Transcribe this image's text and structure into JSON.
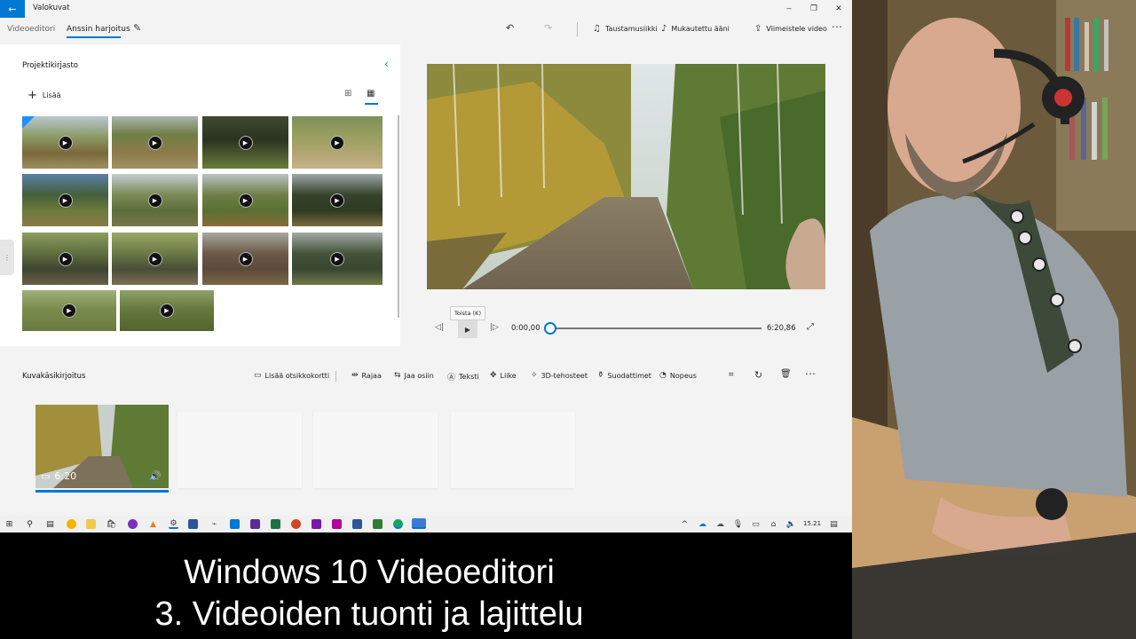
{
  "app": {
    "title": "Valokuvat",
    "back_icon": "back-arrow-icon",
    "window_controls": {
      "minimize": "‒",
      "maximize": "❐",
      "close": "✕"
    }
  },
  "nav": {
    "breadcrumb_root": "Videoeditori",
    "project_name": "Anssin harjoitus",
    "toolbar": {
      "background_music": "Taustamusiikki",
      "custom_audio": "Mukautettu ääni",
      "finish_video": "Viimeistele video"
    }
  },
  "library": {
    "title": "Projektikirjasto",
    "add_label": "Lisää"
  },
  "player": {
    "tooltip": "Toista (K)",
    "time_current": "0:00,00",
    "time_total": "6:20,86",
    "progress": 0
  },
  "storyboard": {
    "title": "Kuvakäsikirjoitus",
    "tools": {
      "title_card": "Lisää otsikkokortti",
      "trim": "Rajaa",
      "split": "Jaa osiin",
      "text": "Teksti",
      "motion": "Liike",
      "effects_3d": "3D-tehosteet",
      "filters": "Suodattimet",
      "speed": "Nopeus"
    },
    "clip_duration": "6:20"
  },
  "taskbar": {
    "clock": "15.21"
  },
  "caption": {
    "line1": "Windows 10 Videoeditori",
    "line2": "3. Videoiden tuonti ja lajittelu"
  },
  "colors": {
    "accent": "#0078d4",
    "selection": "#1e90ff"
  }
}
